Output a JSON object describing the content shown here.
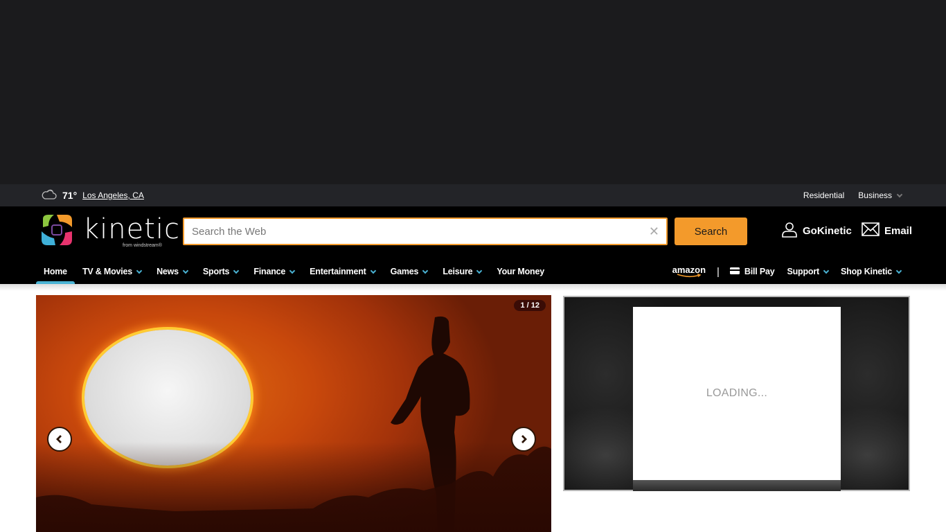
{
  "utility_bar": {
    "weather_icon": "cloud-icon",
    "temperature": "71°",
    "location": "Los Angeles, CA",
    "links": [
      {
        "label": "Residential",
        "has_dropdown": false
      },
      {
        "label": "Business",
        "has_dropdown": true
      }
    ]
  },
  "header": {
    "logo": {
      "wordmark": "kinetic",
      "tagline": "from windstream®"
    },
    "search": {
      "placeholder": "Search the Web",
      "value": "",
      "clear_icon": "close-icon",
      "button_label": "Search"
    },
    "account_links": [
      {
        "label": "GoKinetic",
        "icon": "user-icon"
      },
      {
        "label": "Email",
        "icon": "envelope-icon"
      }
    ]
  },
  "nav": {
    "items": [
      {
        "label": "Home",
        "active": true,
        "has_dropdown": false
      },
      {
        "label": "TV & Movies",
        "has_dropdown": true
      },
      {
        "label": "News",
        "has_dropdown": true
      },
      {
        "label": "Sports",
        "has_dropdown": true
      },
      {
        "label": "Finance",
        "has_dropdown": true
      },
      {
        "label": "Entertainment",
        "has_dropdown": true
      },
      {
        "label": "Games",
        "has_dropdown": true
      },
      {
        "label": "Leisure",
        "has_dropdown": true
      },
      {
        "label": "Your Money",
        "has_dropdown": false
      }
    ],
    "right": {
      "amazon_label": "amazon",
      "separator": "|",
      "bill_pay": {
        "label": "Bill Pay",
        "icon": "credit-card-icon"
      },
      "support": {
        "label": "Support",
        "has_dropdown": true
      },
      "shop": {
        "label": "Shop Kinetic",
        "has_dropdown": true
      }
    }
  },
  "slideshow": {
    "current": 1,
    "total": 12,
    "counter_text": "1 / 12",
    "prev_icon": "chevron-left-icon",
    "next_icon": "chevron-right-icon"
  },
  "side_ad": {
    "status_text": "LOADING..."
  },
  "colors": {
    "accent_orange": "#f39a2b",
    "nav_accent_blue": "#4ab3d4",
    "header_bg": "#000000",
    "utility_bg": "#232428"
  }
}
